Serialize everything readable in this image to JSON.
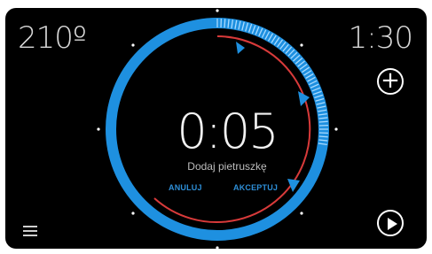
{
  "temperature": "210º",
  "total_time": "1:30",
  "timer": {
    "remaining": "0:05",
    "step_text": "Dodaj pietruszkę",
    "progress_fraction": 0.28
  },
  "actions": {
    "cancel_label": "ANULUJ",
    "accept_label": "AKCEPTUJ",
    "add_icon": "plus-icon",
    "play_icon": "play-icon",
    "menu_icon": "menu-icon"
  },
  "colors": {
    "ring_blue": "#1e90e0",
    "ring_light": "#a9dbff",
    "accent_red": "#d83a3a",
    "text_blue": "#2e8fd8"
  }
}
